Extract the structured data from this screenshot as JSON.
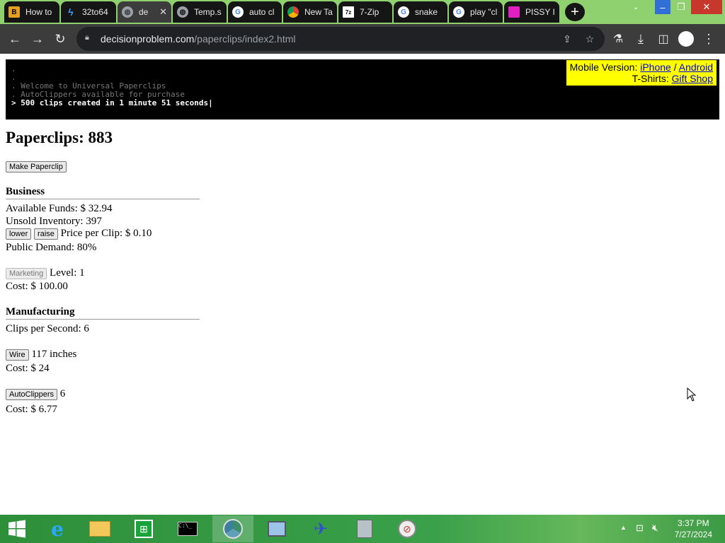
{
  "browser": {
    "tabs": [
      {
        "title": "How to",
        "fav": "eye"
      },
      {
        "title": "32to64",
        "fav": "bolt"
      },
      {
        "title": "de",
        "fav": "globe"
      },
      {
        "title": "Temp.s",
        "fav": "globe"
      },
      {
        "title": "auto cl",
        "fav": "google"
      },
      {
        "title": "New Ta",
        "fav": "chrome"
      },
      {
        "title": "7-Zip",
        "fav": "7zip"
      },
      {
        "title": "snake",
        "fav": "google"
      },
      {
        "title": "play \"cl",
        "fav": "google"
      },
      {
        "title": "PISSY I",
        "fav": "pink"
      }
    ],
    "active_tab": 2,
    "url_host": "decisionproblem.com",
    "url_path": "/paperclips/index2.html"
  },
  "console": {
    "lines": [
      ".",
      ".",
      ". Welcome to Universal Paperclips",
      ". AutoClippers available for purchase"
    ],
    "current": "> 500 clips created in 1 minute 51 seconds|"
  },
  "promo": {
    "mobile_label": "Mobile Version:",
    "iphone": "iPhone",
    "sep": "/",
    "android": "Android",
    "shirts_label": "T-Shirts:",
    "shop": "Gift Shop"
  },
  "game": {
    "clips_heading": "Paperclips: 883",
    "make_button": "Make Paperclip",
    "business": {
      "title": "Business",
      "funds": "Available Funds: $ 32.94",
      "inventory": "Unsold Inventory: 397",
      "lower": "lower",
      "raise": "raise",
      "price": "Price per Clip: $ 0.10",
      "demand": "Public Demand: 80%",
      "marketing_button": "Marketing",
      "marketing_level": "Level: 1",
      "marketing_cost": "Cost: $ 100.00"
    },
    "manufacturing": {
      "title": "Manufacturing",
      "clips_per_second": "Clips per Second: 6",
      "wire_button": "Wire",
      "wire_amount": "117 inches",
      "wire_cost": "Cost: $ 24",
      "autoclippers_button": "AutoClippers",
      "autoclippers_count": "6",
      "autoclippers_cost": "Cost: $ 6.77"
    }
  },
  "taskbar": {
    "time": "3:37 PM",
    "date": "7/27/2024"
  }
}
